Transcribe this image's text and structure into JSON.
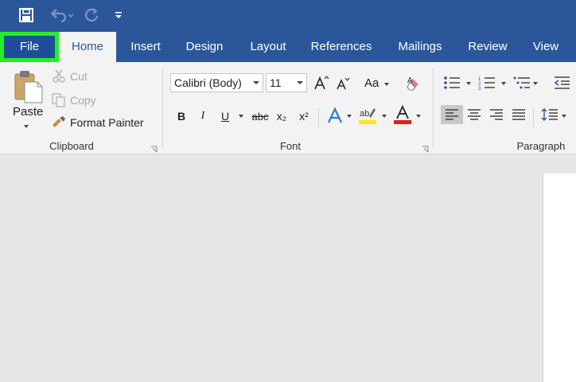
{
  "quick_access": {
    "save_icon": "save-icon",
    "undo_icon": "undo-icon",
    "redo_icon": "redo-icon",
    "customize_icon": "customize-icon"
  },
  "tabs": [
    {
      "label": "File"
    },
    {
      "label": "Home"
    },
    {
      "label": "Insert"
    },
    {
      "label": "Design"
    },
    {
      "label": "Layout"
    },
    {
      "label": "References"
    },
    {
      "label": "Mailings"
    },
    {
      "label": "Review"
    },
    {
      "label": "View"
    }
  ],
  "active_tab": "Home",
  "highlighted_tab": "File",
  "colors": {
    "title_bar": "#2b579a",
    "highlight": "#22ee22",
    "ribbon": "#f3f3f3",
    "font_color_red": "#e02020",
    "highlighter_yellow": "#ffea00"
  },
  "clipboard": {
    "paste_label": "Paste",
    "cut_label": "Cut",
    "copy_label": "Copy",
    "format_painter_label": "Format Painter",
    "group_label": "Clipboard"
  },
  "font": {
    "font_name": "Calibri (Body)",
    "font_size": "11",
    "case_label": "Aa",
    "bold": "B",
    "italic": "I",
    "underline": "U",
    "strikethrough": "abc",
    "subscript": "x₂",
    "superscript": "x²",
    "group_label": "Font"
  },
  "paragraph": {
    "group_label": "Paragraph"
  }
}
